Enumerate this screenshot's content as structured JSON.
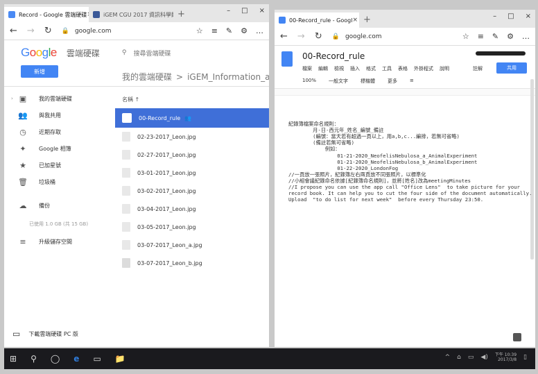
{
  "left_window": {
    "tabs": [
      {
        "label": "Record - Google 雲端硬碟",
        "close": "×"
      },
      {
        "label": "iGEM CGU 2017 資訊科學館",
        "close": ""
      }
    ],
    "new_tab": "+",
    "controls": [
      "–",
      "□",
      "×"
    ],
    "address": {
      "back": "←",
      "forward": "→",
      "refresh": "↻",
      "lock": "🔒",
      "url": "google.com",
      "tools": [
        "☆",
        "≡",
        "✎",
        "⚙",
        "…"
      ]
    },
    "drive": {
      "product": "雲端硬碟",
      "search_placeholder": "搜尋雲端硬碟",
      "new_button": "新增",
      "breadcrumb_root": "我的雲端硬碟",
      "breadcrumb_sep": ">",
      "breadcrumb_current": "iGEM_Information_and_Sim",
      "sidebar": [
        {
          "icon": "▣",
          "label": "我的雲端硬碟",
          "chevron": "›"
        },
        {
          "icon": "👥",
          "label": "與我共用",
          "chevron": ""
        },
        {
          "icon": "◷",
          "label": "近期存取",
          "chevron": ""
        },
        {
          "icon": "✦",
          "label": "Google 相簿",
          "chevron": ""
        },
        {
          "icon": "★",
          "label": "已加星號",
          "chevron": ""
        },
        {
          "icon": "🗑",
          "label": "垃圾桶",
          "chevron": ""
        },
        {
          "icon": "☁",
          "label": "備份",
          "chevron": ""
        }
      ],
      "storage_text": "已使用 1.0 GB (共 15 GB)",
      "upgrade": {
        "icon": "≡",
        "label": "升級儲存空間"
      },
      "column_header": "名稱 ↑",
      "files": [
        {
          "name": "00-Record_rule",
          "selected": true,
          "shared": "👥"
        },
        {
          "name": "02-23-2017_Leon.jpg",
          "selected": false,
          "shared": ""
        },
        {
          "name": "02-27-2017_Leon.jpg",
          "selected": false,
          "shared": ""
        },
        {
          "name": "03-01-2017_Leon.jpg",
          "selected": false,
          "shared": ""
        },
        {
          "name": "03-02-2017_Leon.jpg",
          "selected": false,
          "shared": ""
        },
        {
          "name": "03-04-2017_Leon.jpg",
          "selected": false,
          "shared": ""
        },
        {
          "name": "03-05-2017_Leon.jpg",
          "selected": false,
          "shared": ""
        },
        {
          "name": "03-07-2017_Leon_a.jpg",
          "selected": false,
          "shared": ""
        },
        {
          "name": "03-07-2017_Leon_b.jpg",
          "selected": false,
          "shared": ""
        }
      ],
      "footer": {
        "icon": "▭",
        "label": "下載雲端硬碟 PC 版"
      }
    }
  },
  "right_window": {
    "tabs": [
      {
        "label": "00-Record_rule - Googl",
        "close": "×"
      }
    ],
    "new_tab": "+",
    "controls": [
      "–",
      "□",
      "×"
    ],
    "address": {
      "back": "←",
      "forward": "→",
      "refresh": "↻",
      "lock": "🔒",
      "url": "google.com",
      "tools": [
        "☆",
        "≡",
        "✎",
        "⚙",
        "…"
      ]
    },
    "docs": {
      "title": "00-Record_rule",
      "menus": [
        "檔案",
        "編輯",
        "檢視",
        "插入",
        "格式",
        "工具",
        "表格",
        "外掛程式",
        "說明"
      ],
      "meta": "註解",
      "share_button": "共用",
      "toolbar": [
        "100%",
        "一般文字",
        "標楷體",
        "更多",
        "≡"
      ],
      "content": [
        "紀錄簿檔案命名規則：",
        "",
        "        月-日-西元年_姓名_編號_備註",
        "        (編號：當天若有超過一頁以上，用a,b,c...編排，若無可省略)",
        "        (備註若無可省略)",
        "",
        "            例如：",
        "                01-21-2020_NeofelisNebulosa_a_AnimalExperiment",
        "                01-21-2020_NeofelisNebulosa_b_AnimalExperiment",
        "                01-22-2020_LondonFog",
        "",
        "//一頁放一張照片，紀錄簿左右兩頁放不同張照片，以標準化",
        "",
        "//小組會議紀錄命名依據[紀錄簿命名規則]，並將[姓名]改為meetingMinutes",
        "",
        "//I propose you can use the app call \"Office Lens\"  to take picture for your",
        "record book. It can help you to cut the four side of the document automatically.",
        "",
        "Upload  \"to do list for next week\"  before every Thursday 23:50."
      ]
    }
  },
  "taskbar": {
    "items": [
      "⊞",
      "⚲",
      "◯",
      "e",
      "▭",
      "📁"
    ],
    "tray": [
      "^",
      "⌂",
      "▭",
      "◀)",
      "▯"
    ],
    "clock": {
      "time": "下午 10:39",
      "date": "2017/3/8"
    }
  }
}
